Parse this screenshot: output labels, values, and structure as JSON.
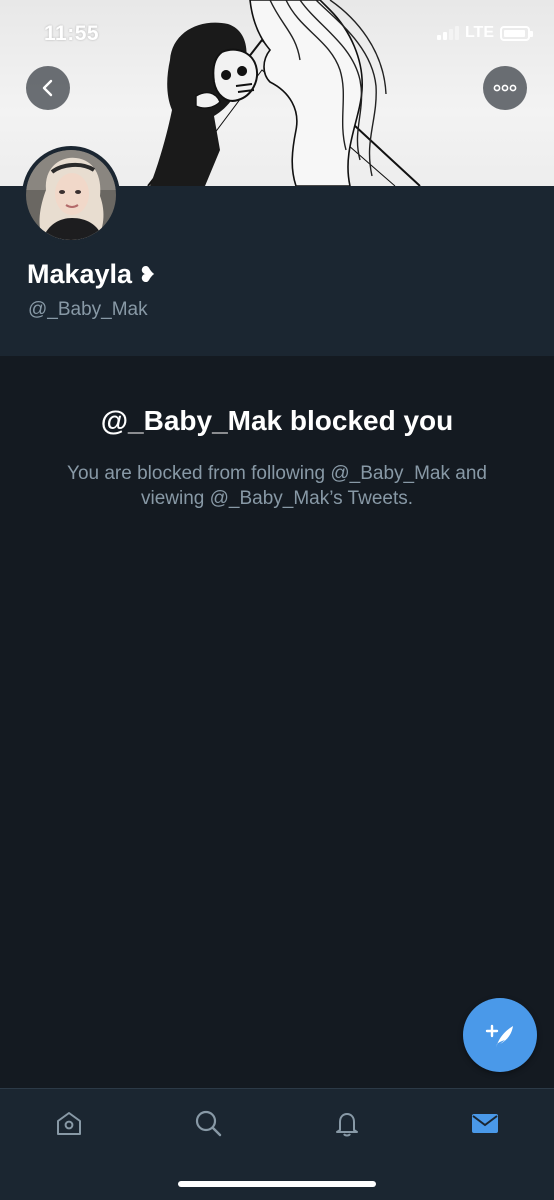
{
  "status_bar": {
    "time": "11:55",
    "network": "LTE"
  },
  "profile": {
    "display_name": "Makayla",
    "name_emoji": "❥",
    "handle": "@_Baby_Mak"
  },
  "blocked": {
    "title": "@_Baby_Mak blocked you",
    "body": "You are blocked from following @_Baby_Mak and viewing @_Baby_Mak’s Tweets."
  },
  "icons": {
    "back": "chevron-left-icon",
    "more": "more-horizontal-icon",
    "compose": "compose-tweet-icon",
    "home": "home-icon",
    "search": "search-icon",
    "notifications": "bell-icon",
    "messages": "mail-icon"
  },
  "colors": {
    "background": "#141a21",
    "profile_background": "#1b2631",
    "accent": "#4a99e9",
    "secondary_text": "#8899a6"
  }
}
